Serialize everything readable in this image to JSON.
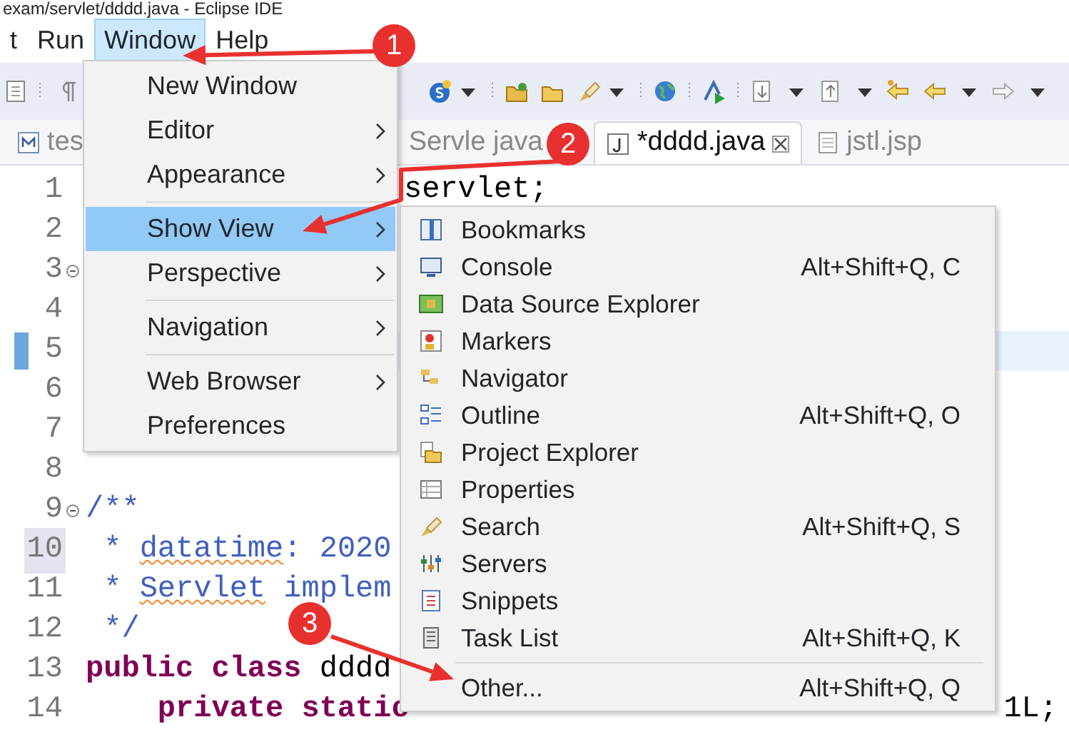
{
  "window": {
    "title": "exam/servlet/dddd.java  -  Eclipse IDE"
  },
  "menu_bar": [
    {
      "label": "t",
      "selected": false
    },
    {
      "label": "Run",
      "selected": false
    },
    {
      "label": "Window",
      "selected": true
    },
    {
      "label": "Help",
      "selected": false
    }
  ],
  "tabs": [
    {
      "label": "tes",
      "kind": "md",
      "selected": false,
      "closable": false
    },
    {
      "label": "Servle java",
      "kind": "none",
      "selected": false,
      "closable": false
    },
    {
      "label": "*dddd.java",
      "kind": "java",
      "selected": true,
      "closable": true
    },
    {
      "label": "jstl.jsp",
      "kind": "jsp",
      "selected": false,
      "closable": false
    }
  ],
  "editor": {
    "lines": [
      {
        "number": "1",
        "current": false,
        "marked": false,
        "foldable": false,
        "parts": [
          {
            "kind": "after-menu",
            "text": "servlet;"
          }
        ]
      },
      {
        "number": "2",
        "current": false,
        "marked": false,
        "foldable": false
      },
      {
        "number": "3",
        "current": false,
        "marked": false,
        "foldable": true
      },
      {
        "number": "4",
        "current": false,
        "marked": false,
        "foldable": false
      },
      {
        "number": "5",
        "current": true,
        "marked": false,
        "foldable": false
      },
      {
        "number": "6",
        "current": false,
        "marked": false,
        "foldable": false
      },
      {
        "number": "7",
        "current": false,
        "marked": false,
        "foldable": false
      },
      {
        "number": "8",
        "current": false,
        "marked": false,
        "foldable": false
      },
      {
        "number": "9",
        "current": false,
        "marked": false,
        "foldable": true,
        "parts": [
          {
            "kind": "comment",
            "text": "/**"
          }
        ]
      },
      {
        "number": "10",
        "current": false,
        "marked": true,
        "foldable": false,
        "parts": [
          {
            "kind": "comment",
            "text": " * "
          },
          {
            "kind": "misspelled",
            "text": "datatime"
          },
          {
            "kind": "comment",
            "text": ": 2020"
          }
        ]
      },
      {
        "number": "11",
        "current": false,
        "marked": false,
        "foldable": false,
        "parts": [
          {
            "kind": "comment",
            "text": " * "
          },
          {
            "kind": "misspelled",
            "text": "Servlet"
          },
          {
            "kind": "comment",
            "text": " implem"
          }
        ]
      },
      {
        "number": "12",
        "current": false,
        "marked": false,
        "foldable": false,
        "parts": [
          {
            "kind": "comment",
            "text": " */"
          }
        ]
      },
      {
        "number": "13",
        "current": false,
        "marked": false,
        "foldable": false,
        "parts": [
          {
            "kind": "keyword",
            "text": "public"
          },
          {
            "kind": "keyword",
            "text": " class"
          },
          {
            "kind": "plain",
            "text": " dddd"
          }
        ]
      },
      {
        "number": "14",
        "current": false,
        "marked": false,
        "foldable": false,
        "parts": [
          {
            "kind": "keyword",
            "text": "    private"
          },
          {
            "kind": "keyword",
            "text": " static"
          },
          {
            "kind": "tail",
            "text": "1L;"
          }
        ]
      }
    ]
  },
  "window_menu": [
    {
      "kind": "item",
      "label": "New Window",
      "submenu": false,
      "selected": false
    },
    {
      "kind": "item",
      "label": "Editor",
      "submenu": true,
      "selected": false
    },
    {
      "kind": "item",
      "label": "Appearance",
      "submenu": true,
      "selected": false
    },
    {
      "kind": "separator"
    },
    {
      "kind": "item",
      "label": "Show View",
      "submenu": true,
      "selected": true
    },
    {
      "kind": "item",
      "label": "Perspective",
      "submenu": true,
      "selected": false
    },
    {
      "kind": "separator"
    },
    {
      "kind": "item",
      "label": "Navigation",
      "submenu": true,
      "selected": false
    },
    {
      "kind": "separator"
    },
    {
      "kind": "item",
      "label": "Web Browser",
      "submenu": true,
      "selected": false
    },
    {
      "kind": "item",
      "label": "Preferences",
      "submenu": false,
      "selected": false
    }
  ],
  "show_view_menu": [
    {
      "kind": "item",
      "label": "Bookmarks"
    },
    {
      "kind": "item",
      "label": "Console",
      "shortcut": "Alt+Shift+Q, C"
    },
    {
      "kind": "item",
      "label": "Data Source Explorer"
    },
    {
      "kind": "item",
      "label": "Markers"
    },
    {
      "kind": "item",
      "label": "Navigator"
    },
    {
      "kind": "item",
      "label": "Outline",
      "shortcut": "Alt+Shift+Q, O"
    },
    {
      "kind": "item",
      "label": "Project Explorer"
    },
    {
      "kind": "item",
      "label": "Properties"
    },
    {
      "kind": "item",
      "label": "Search",
      "shortcut": "Alt+Shift+Q, S"
    },
    {
      "kind": "item",
      "label": "Servers"
    },
    {
      "kind": "item",
      "label": "Snippets"
    },
    {
      "kind": "item",
      "label": "Task List",
      "shortcut": "Alt+Shift+Q, K"
    },
    {
      "kind": "separator"
    },
    {
      "kind": "item",
      "label": "Other...",
      "shortcut": "Alt+Shift+Q, Q"
    }
  ],
  "annotations": [
    {
      "number": "1"
    },
    {
      "number": "2"
    },
    {
      "number": "3"
    }
  ]
}
